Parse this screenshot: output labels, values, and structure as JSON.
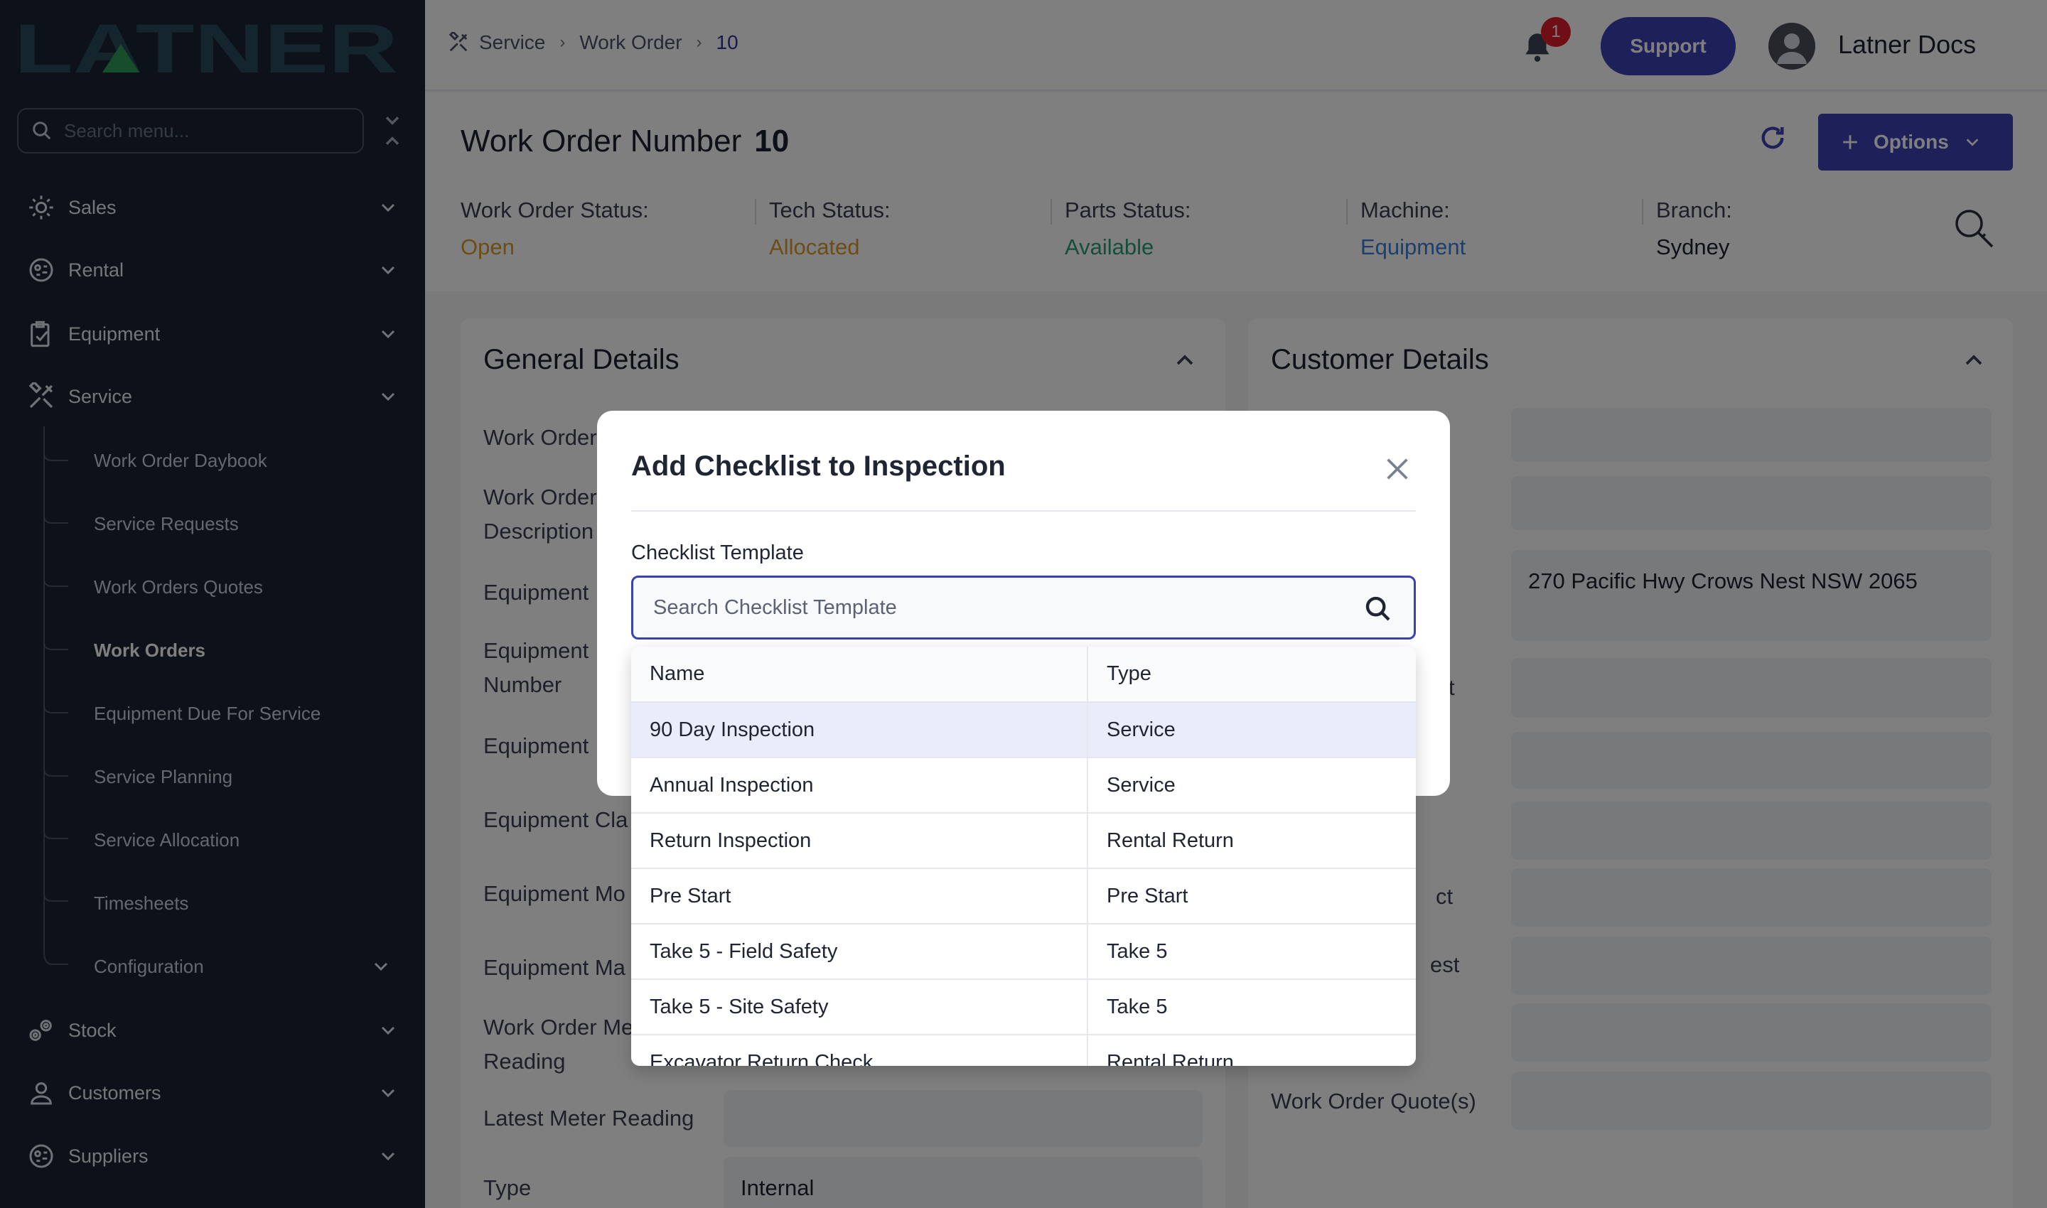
{
  "sidebar": {
    "logo_text": "LATNER",
    "search_placeholder": "Search menu...",
    "items": [
      {
        "label": "Sales",
        "icon": "sales-icon"
      },
      {
        "label": "Rental",
        "icon": "rental-icon"
      },
      {
        "label": "Equipment",
        "icon": "clipboard-icon"
      },
      {
        "label": "Service",
        "icon": "tools-icon"
      },
      {
        "label": "Stock",
        "icon": "stock-icon"
      },
      {
        "label": "Customers",
        "icon": "person-icon"
      },
      {
        "label": "Suppliers",
        "icon": "suppliers-icon"
      }
    ],
    "service_sub": [
      "Work Order Daybook",
      "Service Requests",
      "Work Orders Quotes",
      "Work Orders",
      "Equipment Due For Service",
      "Service Planning",
      "Service Allocation",
      "Timesheets",
      "Configuration"
    ],
    "active_sub": "Work Orders"
  },
  "topbar": {
    "breadcrumb": [
      "Service",
      "Work Order",
      "10"
    ],
    "notification_count": "1",
    "support_label": "Support",
    "user_name": "Latner Docs"
  },
  "header": {
    "title": "Work Order Number",
    "number": "10",
    "options_label": "Options",
    "statuses": [
      {
        "label": "Work Order Status:",
        "value": "Open",
        "color": "#d99a2b"
      },
      {
        "label": "Tech Status:",
        "value": "Allocated",
        "color": "#d99a2b"
      },
      {
        "label": "Parts Status:",
        "value": "Available",
        "color": "#2a9d78"
      },
      {
        "label": "Machine:",
        "value": "Equipment",
        "color": "#3a7fd5"
      },
      {
        "label": "Branch:",
        "value": "Sydney",
        "color": "#1c2030"
      }
    ]
  },
  "general": {
    "title": "General Details",
    "labels": [
      "Work Order",
      "Work Order\nDescription",
      "Equipment",
      "Equipment\nNumber",
      "Equipment",
      "Equipment Cla",
      "Equipment Mo",
      "Equipment Ma",
      "Work Order Me\nReading",
      "Latest Meter Reading",
      "Type"
    ],
    "type_value": "Internal"
  },
  "customer": {
    "title": "Customer Details",
    "address": "270 Pacific Hwy Crows Nest NSW 2065",
    "partial_labels": [
      "t",
      "ct",
      "est"
    ],
    "quote_label": "Work Order Quote(s)"
  },
  "modal": {
    "title": "Add Checklist to Inspection",
    "field_label": "Checklist Template",
    "search_placeholder": "Search Checklist Template",
    "columns": [
      "Name",
      "Type"
    ],
    "rows": [
      {
        "name": "90 Day Inspection",
        "type": "Service"
      },
      {
        "name": "Annual Inspection",
        "type": "Service"
      },
      {
        "name": "Return Inspection",
        "type": "Rental Return"
      },
      {
        "name": "Pre Start",
        "type": "Pre Start"
      },
      {
        "name": "Take 5 - Field Safety",
        "type": "Take 5"
      },
      {
        "name": "Take 5 - Site Safety",
        "type": "Take 5"
      },
      {
        "name": "Excavator Return Check",
        "type": "Rental Return"
      }
    ]
  },
  "colors": {
    "primary": "#3a41b3",
    "sidebar_bg": "#1a2434",
    "logo_green": "#2f9a57",
    "logo_slate": "#2b4a5c"
  }
}
